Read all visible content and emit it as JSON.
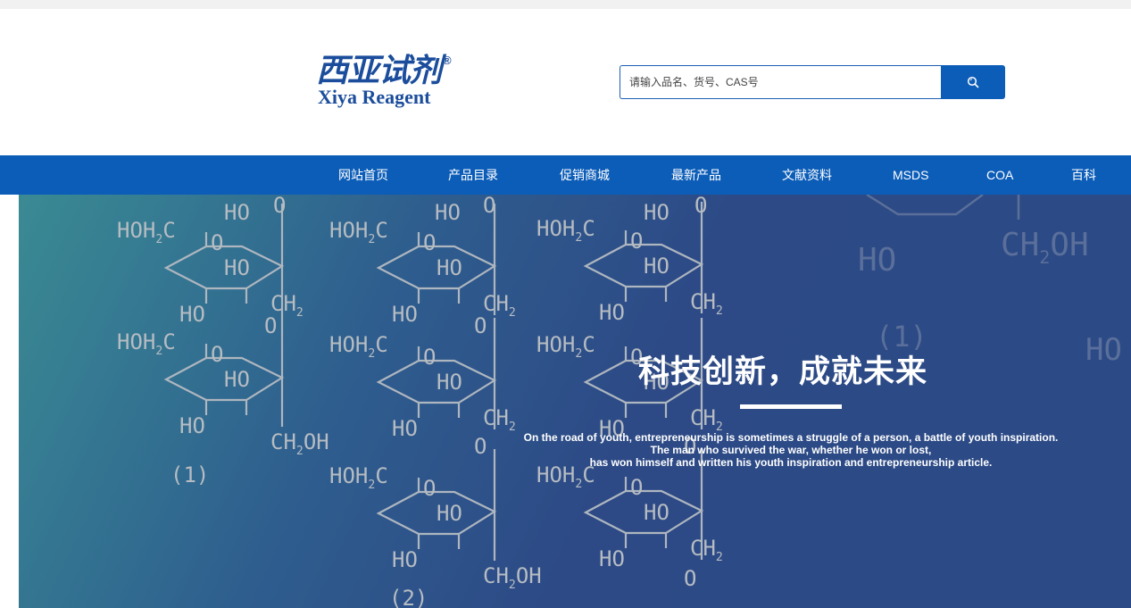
{
  "logo": {
    "cn": "西亚试剂",
    "en": "Xiya Reagent",
    "reg": "®"
  },
  "search": {
    "placeholder": "请输入品名、货号、CAS号",
    "icon": "search-icon"
  },
  "nav": {
    "items": [
      "网站首页",
      "产品目录",
      "促销商城",
      "最新产品",
      "文献资料",
      "MSDS",
      "COA",
      "百科"
    ]
  },
  "banner": {
    "slogan": "科技创新，成就未来",
    "quote_lines": [
      "On the road of youth, entrepreneurship is sometimes a struggle of a person, a battle of youth inspiration.",
      "The man who survived the war, whether he won or lost,",
      "has won himself and written his youth inspiration and entrepreneurship article."
    ]
  },
  "colors": {
    "brand_blue": "#0c5db8",
    "logo_blue": "#1b4d9c",
    "banner_dark": "#2b4a86",
    "banner_teal": "#3a8a93"
  }
}
